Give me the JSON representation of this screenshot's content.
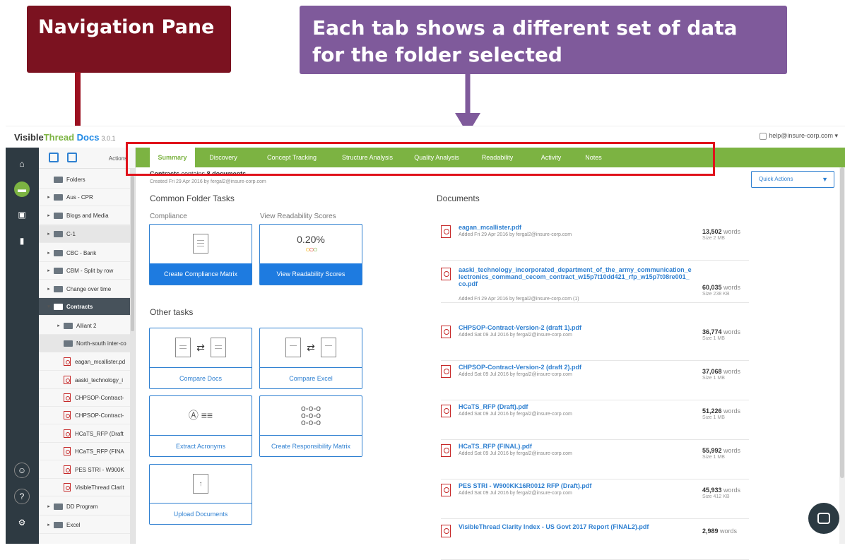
{
  "callouts": {
    "navigation": "Navigation Pane",
    "tabs": "Each tab shows a different set of data for the folder selected"
  },
  "brand": {
    "name_a": "Visible",
    "name_b": "Thread",
    "name_c": "Docs",
    "version": "3.0.1"
  },
  "user": {
    "email": "help@insure-corp.com"
  },
  "pane": {
    "actions_label": "Actions",
    "tree": [
      {
        "label": "Folders",
        "kind": "root"
      },
      {
        "label": "Aus - CPR",
        "kind": "folder"
      },
      {
        "label": "Blogs and Media",
        "kind": "folder"
      },
      {
        "label": "C-1",
        "kind": "folder"
      },
      {
        "label": "CBC - Bank",
        "kind": "folder"
      },
      {
        "label": "CBM - Split by row",
        "kind": "folder"
      },
      {
        "label": "Change over time",
        "kind": "folder"
      },
      {
        "label": "Contracts",
        "kind": "folder-active"
      },
      {
        "label": "Alliant 2",
        "kind": "subfolder"
      },
      {
        "label": "North-south inter-co",
        "kind": "subfolder-nocaret"
      },
      {
        "label": "eagan_mcallister.pd",
        "kind": "file"
      },
      {
        "label": "aaski_technology_i",
        "kind": "file"
      },
      {
        "label": "CHPSOP-Contract-",
        "kind": "file"
      },
      {
        "label": "CHPSOP-Contract-",
        "kind": "file"
      },
      {
        "label": "HCaTS_RFP (Draft",
        "kind": "file"
      },
      {
        "label": "HCaTS_RFP (FINA",
        "kind": "file"
      },
      {
        "label": "PES STRI - W900K",
        "kind": "file"
      },
      {
        "label": "VisibleThread Clarit",
        "kind": "file"
      },
      {
        "label": "DD Program",
        "kind": "folder"
      },
      {
        "label": "Excel",
        "kind": "folder"
      }
    ]
  },
  "tabs": [
    "Summary",
    "Discovery",
    "Concept Tracking",
    "Structure Analysis",
    "Quality Analysis",
    "Readability",
    "Activity",
    "Notes"
  ],
  "summary": {
    "folder": "Contracts",
    "contains": "contains",
    "count": "8 documents",
    "created": "Created Fri 29 Apr 2016 by fergal2@insure-corp.com",
    "quick_actions": "Quick Actions",
    "common_tasks": "Common Folder Tasks",
    "compliance_label": "Compliance",
    "readability_label": "View Readability Scores",
    "readability_score": "0.20%",
    "create_compliance": "Create Compliance Matrix",
    "view_readability": "View Readability Scores",
    "other_tasks": "Other tasks",
    "compare_docs": "Compare Docs",
    "compare_excel": "Compare Excel",
    "extract_acronyms": "Extract Acronyms",
    "create_responsibility": "Create Responsibility Matrix",
    "upload_documents": "Upload Documents",
    "documents_title": "Documents"
  },
  "documents": [
    {
      "name": "eagan_mcallister.pdf",
      "meta": "Added Fri 29 Apr 2016 by fergal2@insure-corp.com",
      "words": "13,502",
      "size": "Size 2 MB"
    },
    {
      "name": "aaski_technology_incorporated_department_of_the_army_communication_electronics_command_cecom_contract_w15p7t10dd421_rfp_w15p7t08re001_co.pdf",
      "meta": "Added Fri 29 Apr 2016 by fergal2@insure-corp.com  (1)",
      "words": "60,035",
      "size": "Size 238 KB"
    },
    {
      "name": "CHPSOP-Contract-Version-2 (draft 1).pdf",
      "meta": "Added Sat 09 Jul 2016 by fergal2@insure-corp.com",
      "words": "36,774",
      "size": "Size 1 MB"
    },
    {
      "name": "CHPSOP-Contract-Version-2 (draft 2).pdf",
      "meta": "Added Sat 09 Jul 2016 by fergal2@insure-corp.com",
      "words": "37,068",
      "size": "Size 1 MB"
    },
    {
      "name": "HCaTS_RFP (Draft).pdf",
      "meta": "Added Sat 09 Jul 2016 by fergal2@insure-corp.com",
      "words": "51,226",
      "size": "Size 1 MB"
    },
    {
      "name": "HCaTS_RFP (FINAL).pdf",
      "meta": "Added Sat 09 Jul 2016 by fergal2@insure-corp.com",
      "words": "55,992",
      "size": "Size 1 MB"
    },
    {
      "name": "PES STRI - W900KK16R0012 RFP (Draft).pdf",
      "meta": "Added Sat 09 Jul 2016 by fergal2@insure-corp.com",
      "words": "45,933",
      "size": "Size 412 KB"
    },
    {
      "name": "VisibleThread Clarity Index - US Govt 2017 Report (FINAL2).pdf",
      "meta": "",
      "words": "2,989",
      "size": ""
    }
  ],
  "words_suffix": "words"
}
